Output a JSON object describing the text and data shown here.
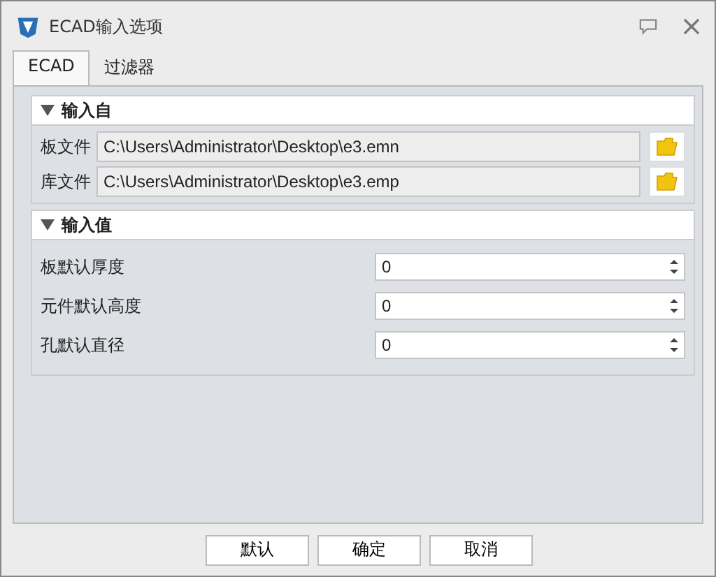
{
  "window": {
    "title": "ECAD输入选项"
  },
  "tabs": [
    {
      "label": "ECAD",
      "selected": true
    },
    {
      "label": "过滤器",
      "selected": false
    }
  ],
  "sections": [
    {
      "title": "输入自",
      "expanded": true,
      "kind": "files",
      "rows": [
        {
          "label": "板文件",
          "value": "C:\\Users\\Administrator\\Desktop\\e3.emn"
        },
        {
          "label": "库文件",
          "value": "C:\\Users\\Administrator\\Desktop\\e3.emp"
        }
      ]
    },
    {
      "title": "输入值",
      "expanded": true,
      "kind": "numbers",
      "rows": [
        {
          "label": "板默认厚度",
          "value": "0"
        },
        {
          "label": "元件默认高度",
          "value": "0"
        },
        {
          "label": "孔默认直径",
          "value": "0"
        }
      ]
    }
  ],
  "buttons": [
    "默认",
    "确定",
    "取消"
  ]
}
